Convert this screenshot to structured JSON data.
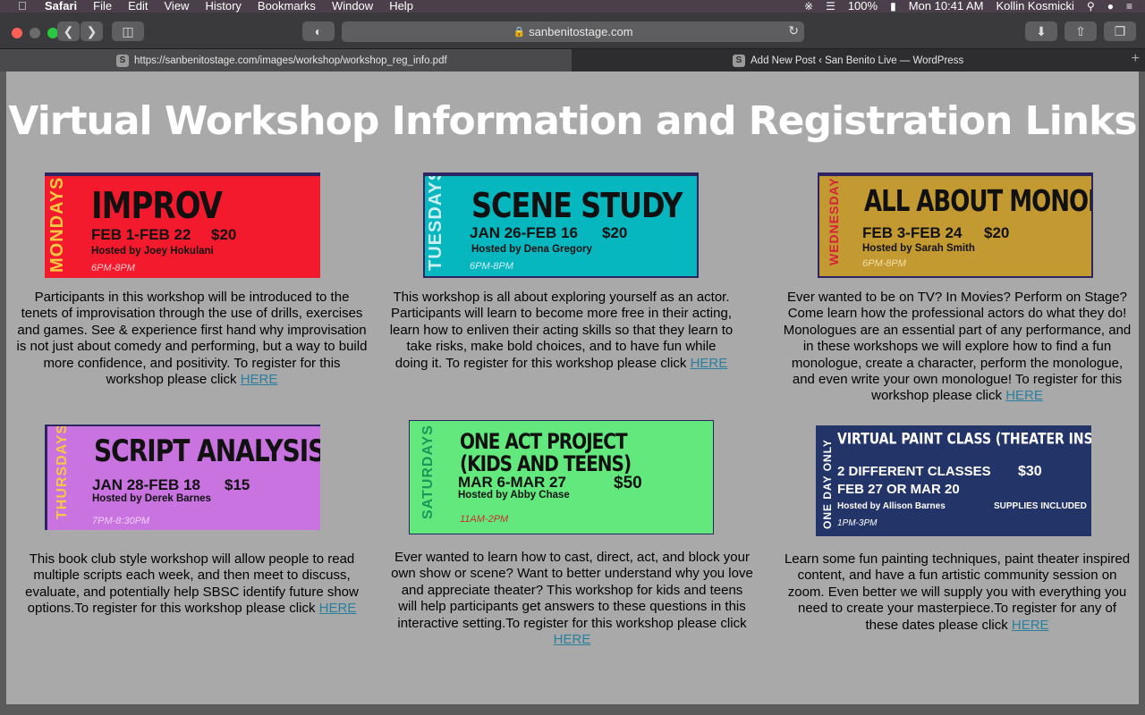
{
  "menubar": {
    "app": "Safari",
    "items": [
      "File",
      "Edit",
      "View",
      "History",
      "Bookmarks",
      "Window",
      "Help"
    ],
    "battery": "100%",
    "clock": "Mon 10:41 AM",
    "user": "Kollin Kosmicki"
  },
  "toolbar": {
    "url": "sanbenitostage.com"
  },
  "tabs": [
    {
      "favicon": "S",
      "label": "https://sanbenitostage.com/images/workshop/workshop_reg_info.pdf"
    },
    {
      "favicon": "S",
      "label": "Add New Post ‹ San Benito Live — WordPress"
    }
  ],
  "page": {
    "title": "Virtual Workshop Information and Registration Links",
    "link_text": "HERE"
  },
  "workshops": [
    {
      "day": "MONDAYS",
      "title": "IMPROV",
      "dates": "FEB 1-FEB 22",
      "price": "$20",
      "host": "Hosted by Joey Hokulani",
      "time": "6PM-8PM",
      "bg": "#f41a2e",
      "day_color": "#f5c842",
      "description": "Participants in this workshop will be introduced to the tenets of improvisation through the use of drills, exercises and games. See & experience first hand why improvisation is not just about comedy and performing, but a way to build more confidence, and positivity. To register for this workshop please click"
    },
    {
      "day": "TUESDAYS",
      "title": "SCENE STUDY",
      "dates": "JAN 26-FEB 16",
      "price": "$20",
      "host": "Hosted by Dena Gregory",
      "time": "6PM-8PM",
      "bg": "#07b7bf",
      "day_color": "#cfeff2",
      "description": "This workshop is all about exploring yourself as an actor. Participants will learn to become more free in their acting, learn how to enliven their acting skills so that they learn to take risks, make bold choices, and to have fun while doing it. To register for this workshop please click"
    },
    {
      "day": "WEDNESDAYS",
      "title": "ALL ABOUT MONOLOGUES",
      "dates": "FEB 3-FEB 24",
      "price": "$20",
      "host": "Hosted by Sarah Smith",
      "time": "6PM-8PM",
      "bg": "#c39a32",
      "day_color": "#d9203b",
      "description": "Ever wanted to be on TV? In Movies? Perform on Stage? Come learn how the professional actors do what they do! Monologues are an essential part of any performance, and in these workshops we will explore how to find a fun monologue, create a character, perform the monologue, and even write your own monologue! To register for this workshop please click"
    },
    {
      "day": "THURSDAYS",
      "title": "SCRIPT ANALYSIS",
      "dates": "JAN 28-FEB 18",
      "price": "$15",
      "host": "Hosted by Derek Barnes",
      "time": "7PM-8:30PM",
      "bg": "#c873e0",
      "day_color": "#f5c842",
      "description": "This book club style workshop will allow people to read multiple scripts each week, and then meet to discuss, evaluate, and potentially help SBSC identify future show options.To register for this workshop please click"
    },
    {
      "day": "SATURDAYS",
      "title": "ONE ACT PROJECT",
      "title2": "(KIDS AND TEENS)",
      "dates": "MAR 6-MAR 27",
      "price": "$50",
      "host": "Hosted by Abby Chase",
      "time": "11AM-2PM",
      "bg": "#63e87e",
      "day_color": "#16995a",
      "description": "Ever wanted to learn how to cast, direct, act, and block your own show or scene? Want to better understand why you love and appreciate theater? This workshop for kids and teens will help participants get answers to these questions in this interactive setting.To register for this workshop please click"
    },
    {
      "day": "ONE DAY ONLY",
      "title": "VIRTUAL PAINT CLASS (THEATER INSPIRED)",
      "dates": "2 DIFFERENT CLASSES",
      "dates2": "FEB 27 OR MAR 20",
      "price": "$30",
      "host": "Hosted by Allison Barnes",
      "time": "1PM-3PM",
      "extra": "SUPPLIES INCLUDED",
      "bg": "#233468",
      "day_color": "#ffffff",
      "description": "Learn some fun painting techniques, paint theater inspired content, and have a fun artistic community session on zoom. Even better we will supply you with everything you need to create your masterpiece.To register for any of these dates please click"
    }
  ]
}
